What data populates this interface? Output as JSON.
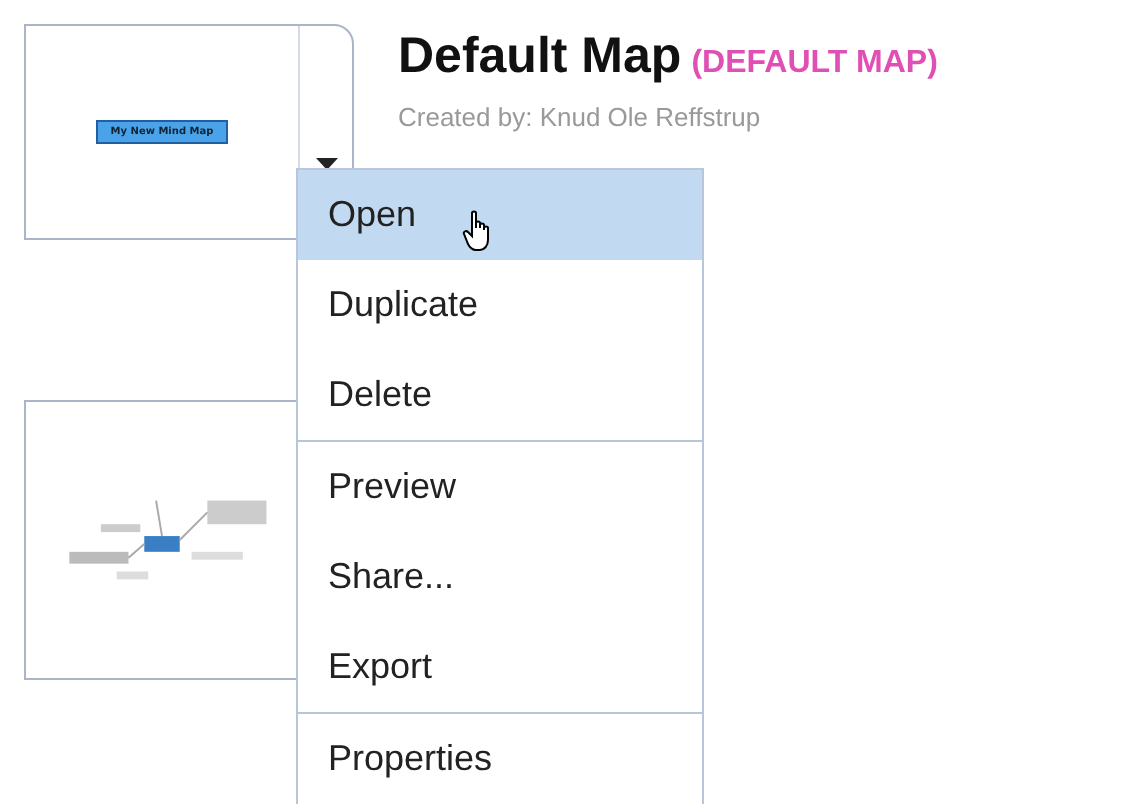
{
  "maps": [
    {
      "title": "Default Map",
      "tag": "(DEFAULT MAP)",
      "creator": "Created by: Knud Ole Reffstrup",
      "thumbnail_label": "My New Mind Map"
    },
    {
      "kind": "picture"
    }
  ],
  "menu": {
    "groups": [
      [
        {
          "label": "Open",
          "selected": true
        },
        {
          "label": "Duplicate",
          "selected": false
        },
        {
          "label": "Delete",
          "selected": false
        }
      ],
      [
        {
          "label": "Preview",
          "selected": false
        },
        {
          "label": "Share...",
          "selected": false
        },
        {
          "label": "Export",
          "selected": false
        }
      ],
      [
        {
          "label": "Properties",
          "selected": false
        }
      ]
    ]
  }
}
